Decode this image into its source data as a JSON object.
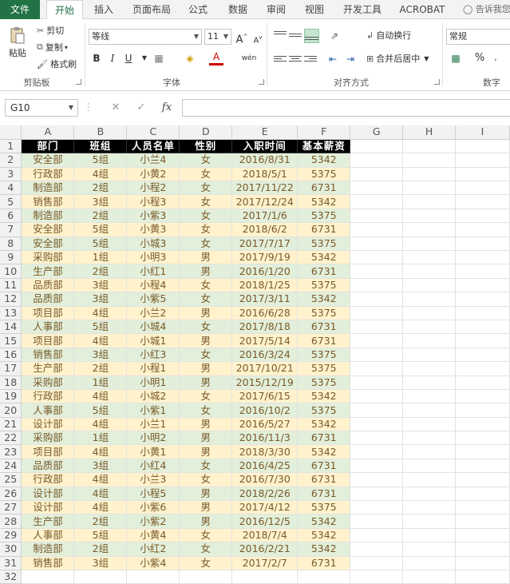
{
  "tabs": [
    "文件",
    "开始",
    "插入",
    "页面布局",
    "公式",
    "数据",
    "审阅",
    "视图",
    "开发工具",
    "ACROBAT"
  ],
  "tell_me": "告诉我您",
  "ribbon": {
    "clipboard": {
      "paste": "粘贴",
      "cut": "剪切",
      "copy": "复制",
      "format_painter": "格式刷",
      "label": "剪贴板"
    },
    "font": {
      "name": "等线",
      "size": "11",
      "bold": "B",
      "italic": "I",
      "underline": "U",
      "grow": "A",
      "shrink": "A",
      "phonetic": "wén",
      "label": "字体"
    },
    "alignment": {
      "wrap": "自动换行",
      "merge": "合并后居中",
      "label": "对齐方式"
    },
    "number": {
      "format": "常规",
      "percent": "%",
      "label": "数字"
    }
  },
  "formula_bar": {
    "cell_ref": "G10",
    "fx": "fx",
    "cancel": "✕",
    "confirm": "✓",
    "value": ""
  },
  "columns": [
    "A",
    "B",
    "C",
    "D",
    "E",
    "F",
    "G",
    "H",
    "I"
  ],
  "header": [
    "部门",
    "班组",
    "人员名单",
    "性别",
    "入职时间",
    "基本薪资"
  ],
  "rows": [
    [
      "安全部",
      "5组",
      "小兰4",
      "女",
      "2016/8/31",
      "5342"
    ],
    [
      "行政部",
      "4组",
      "小黄2",
      "女",
      "2018/5/1",
      "5375"
    ],
    [
      "制造部",
      "2组",
      "小程2",
      "女",
      "2017/11/22",
      "6731"
    ],
    [
      "销售部",
      "3组",
      "小程3",
      "女",
      "2017/12/24",
      "5342"
    ],
    [
      "制造部",
      "2组",
      "小紫3",
      "女",
      "2017/1/6",
      "5375"
    ],
    [
      "安全部",
      "5组",
      "小黄3",
      "女",
      "2018/6/2",
      "6731"
    ],
    [
      "安全部",
      "5组",
      "小城3",
      "女",
      "2017/7/17",
      "5375"
    ],
    [
      "采购部",
      "1组",
      "小明3",
      "男",
      "2017/9/19",
      "5342"
    ],
    [
      "生产部",
      "2组",
      "小红1",
      "男",
      "2016/1/20",
      "6731"
    ],
    [
      "品质部",
      "3组",
      "小程4",
      "女",
      "2018/1/25",
      "5375"
    ],
    [
      "品质部",
      "3组",
      "小紫5",
      "女",
      "2017/3/11",
      "5342"
    ],
    [
      "项目部",
      "4组",
      "小兰2",
      "男",
      "2016/6/28",
      "5375"
    ],
    [
      "人事部",
      "5组",
      "小城4",
      "女",
      "2017/8/18",
      "6731"
    ],
    [
      "项目部",
      "4组",
      "小城1",
      "男",
      "2017/5/14",
      "6731"
    ],
    [
      "销售部",
      "3组",
      "小红3",
      "女",
      "2016/3/24",
      "5375"
    ],
    [
      "生产部",
      "2组",
      "小程1",
      "男",
      "2017/10/21",
      "5375"
    ],
    [
      "采购部",
      "1组",
      "小明1",
      "男",
      "2015/12/19",
      "5375"
    ],
    [
      "行政部",
      "4组",
      "小城2",
      "女",
      "2017/6/15",
      "5342"
    ],
    [
      "人事部",
      "5组",
      "小紫1",
      "女",
      "2016/10/2",
      "5375"
    ],
    [
      "设计部",
      "4组",
      "小兰1",
      "男",
      "2016/5/27",
      "5342"
    ],
    [
      "采购部",
      "1组",
      "小明2",
      "男",
      "2016/11/3",
      "6731"
    ],
    [
      "项目部",
      "4组",
      "小黄1",
      "男",
      "2018/3/30",
      "5342"
    ],
    [
      "品质部",
      "3组",
      "小红4",
      "女",
      "2016/4/25",
      "6731"
    ],
    [
      "行政部",
      "4组",
      "小兰3",
      "女",
      "2016/7/30",
      "6731"
    ],
    [
      "设计部",
      "4组",
      "小程5",
      "男",
      "2018/2/26",
      "6731"
    ],
    [
      "设计部",
      "4组",
      "小紫6",
      "男",
      "2017/4/12",
      "5375"
    ],
    [
      "生产部",
      "2组",
      "小紫2",
      "男",
      "2016/12/5",
      "5342"
    ],
    [
      "人事部",
      "5组",
      "小黄4",
      "女",
      "2018/7/4",
      "5342"
    ],
    [
      "制造部",
      "2组",
      "小红2",
      "女",
      "2016/2/21",
      "5342"
    ],
    [
      "销售部",
      "3组",
      "小紫4",
      "女",
      "2017/2/7",
      "6731"
    ]
  ],
  "row_numbers": [
    "1",
    "2",
    "3",
    "4",
    "5",
    "6",
    "7",
    "8",
    "9",
    "10",
    "11",
    "12",
    "13",
    "14",
    "15",
    "16",
    "17",
    "18",
    "19",
    "20",
    "21",
    "22",
    "23",
    "24",
    "25",
    "26",
    "27",
    "28",
    "29",
    "30",
    "31",
    "32"
  ],
  "colors": {
    "accent": "#217346",
    "header_fill": "#000000",
    "band_green": "#e2efda",
    "band_yellow": "#fff2cc"
  }
}
